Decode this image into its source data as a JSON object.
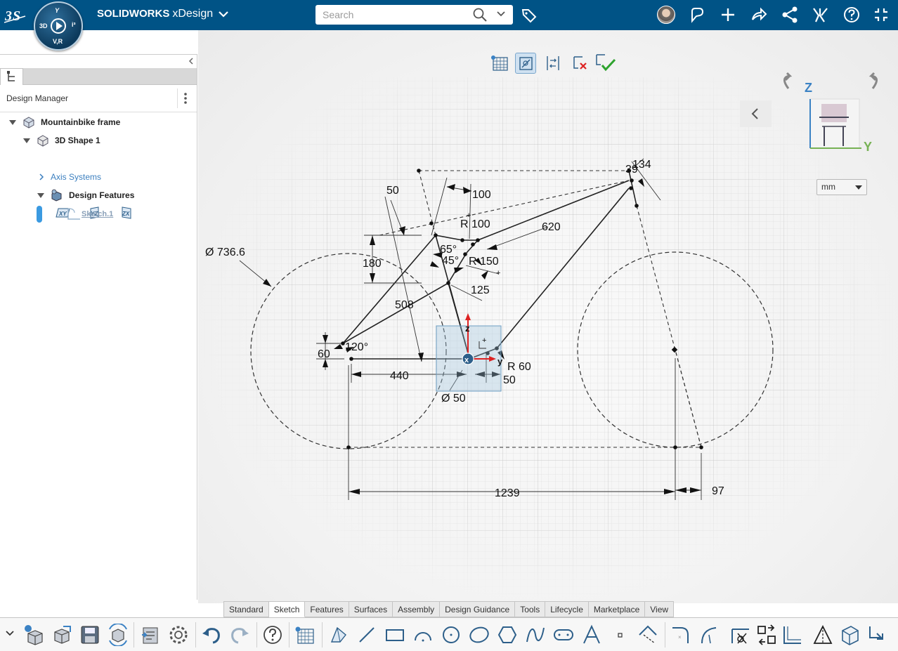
{
  "header": {
    "brand": "SOLIDWORKS",
    "app": "xDesign",
    "compass_labels": [
      "3D",
      "V,R",
      "i³"
    ],
    "search_placeholder": "Search"
  },
  "sketch_toolbar": {
    "items": [
      "grid-snap-icon",
      "sketch-constraints-icon",
      "dimension-toggle-icon",
      "cancel-sketch-icon",
      "exit-sketch-icon"
    ]
  },
  "design_manager": {
    "title": "Design Manager",
    "tree": [
      {
        "label": "Mountainbike frame",
        "level": 0,
        "expanded": true
      },
      {
        "label": "3D Shape 1",
        "level": 1,
        "expanded": true
      },
      {
        "label": "Axis Systems",
        "level": 2
      },
      {
        "label": "Design Features",
        "level": 2,
        "expanded": true
      },
      {
        "label": "Sketch.1",
        "level": 3
      }
    ],
    "planes": [
      "XY",
      "YZ",
      "ZX"
    ]
  },
  "canvas": {
    "units": "mm",
    "axis_labels": [
      "Z",
      "Y"
    ],
    "dimensions": [
      "Ø 736.6",
      "50",
      "100",
      "R 100",
      "620",
      "65°",
      "45°",
      "R 150",
      "180",
      "125",
      "508",
      "60",
      "120°",
      "440",
      "R 60",
      "50",
      "Ø 50",
      "1239",
      "97",
      "134",
      "39"
    ]
  },
  "bottom_tabs": {
    "items": [
      "Standard",
      "Sketch",
      "Features",
      "Surfaces",
      "Assembly",
      "Design Guidance",
      "Tools",
      "Lifecycle",
      "Marketplace",
      "View"
    ],
    "active": "Sketch"
  }
}
